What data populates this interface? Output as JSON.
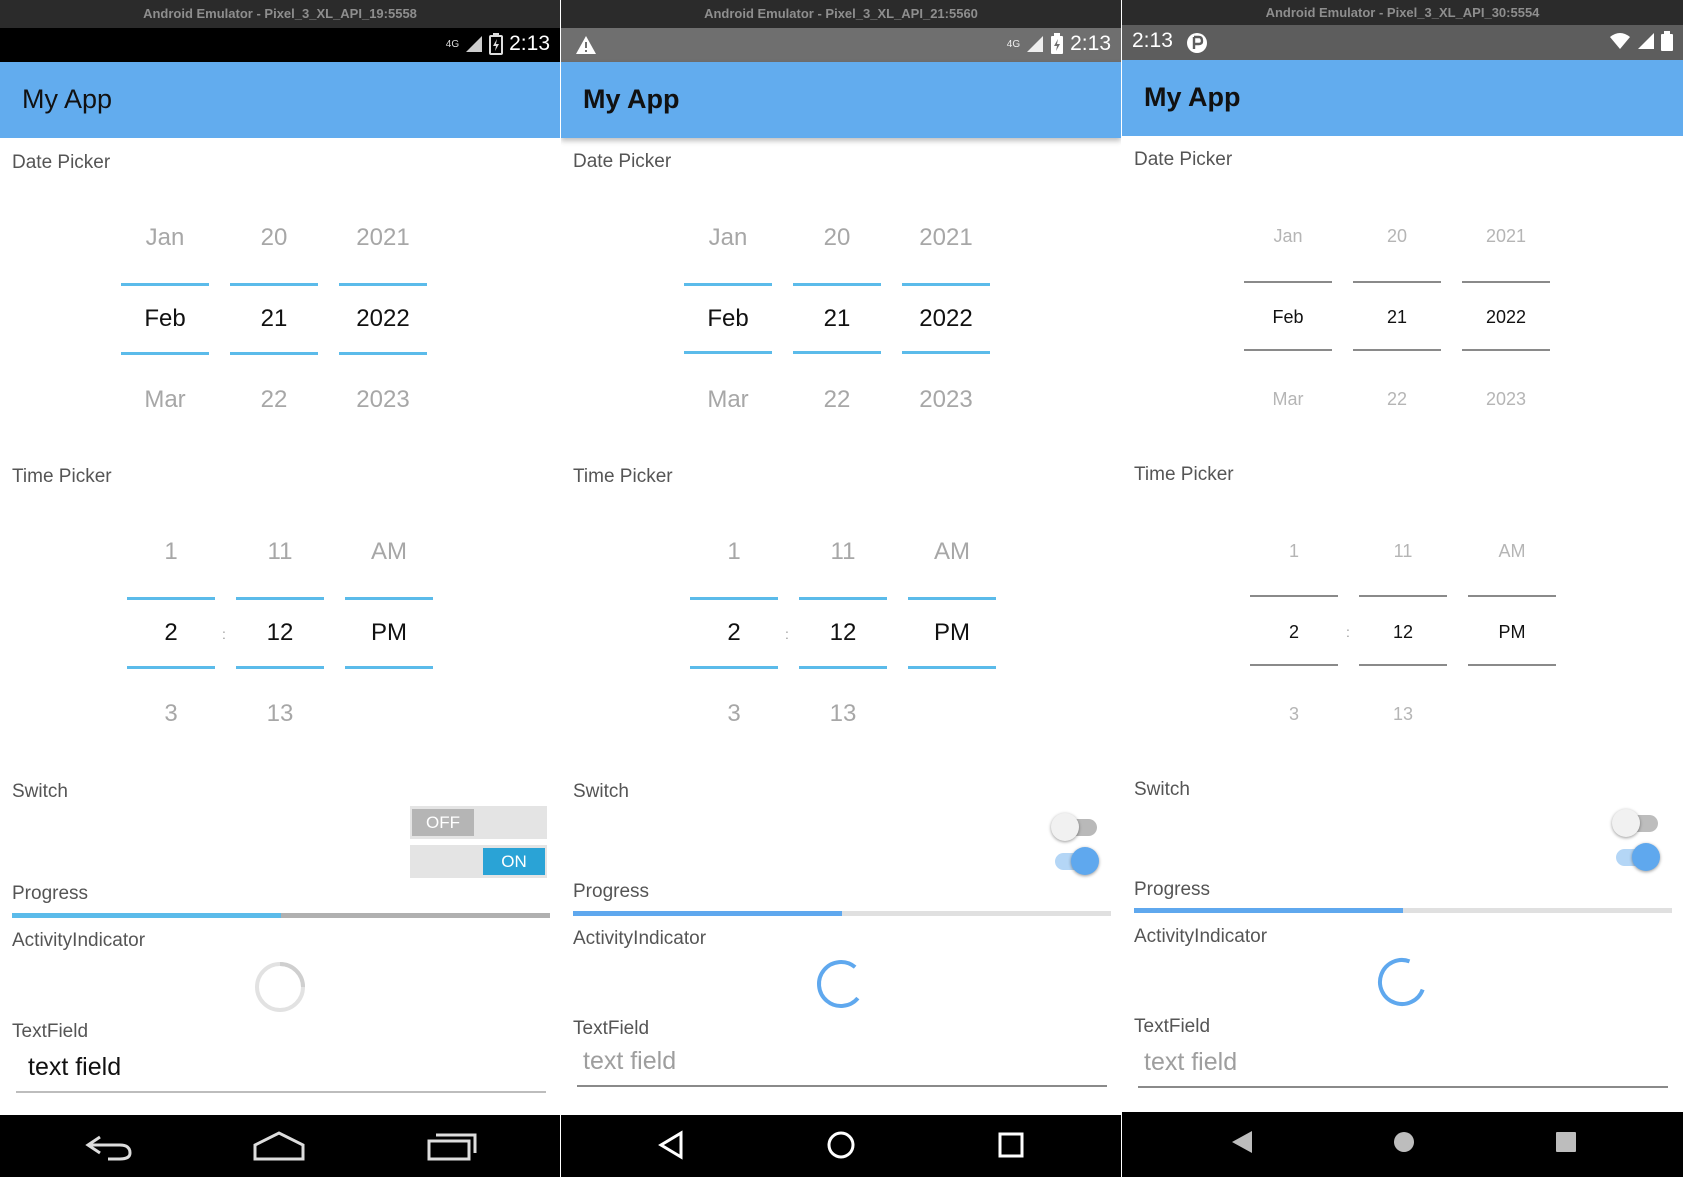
{
  "emulators": [
    {
      "window_title": "Android Emulator - Pixel_3_XL_API_19:5558",
      "status_time": "2:13",
      "status_network": "4G",
      "app_title": "My App",
      "labels": {
        "date": "Date Picker",
        "time": "Time Picker",
        "switch": "Switch",
        "progress": "Progress",
        "activity": "ActivityIndicator",
        "textfield": "TextField"
      },
      "date_picker": {
        "months": [
          "Jan",
          "Feb",
          "Mar"
        ],
        "days": [
          "20",
          "21",
          "22"
        ],
        "years": [
          "2021",
          "2022",
          "2023"
        ]
      },
      "time_picker": {
        "hours": [
          "1",
          "2",
          "3"
        ],
        "minutes": [
          "11",
          "12",
          "13"
        ],
        "ampm": [
          "AM",
          "PM"
        ],
        "separator": ":"
      },
      "switches": {
        "off_label": "OFF",
        "on_label": "ON"
      },
      "progress": 0.5,
      "textfield_value": "text field"
    },
    {
      "window_title": "Android Emulator - Pixel_3_XL_API_21:5560",
      "status_time": "2:13",
      "status_network": "4G",
      "app_title": "My App",
      "labels": {
        "date": "Date Picker",
        "time": "Time Picker",
        "switch": "Switch",
        "progress": "Progress",
        "activity": "ActivityIndicator",
        "textfield": "TextField"
      },
      "date_picker": {
        "months": [
          "Jan",
          "Feb",
          "Mar"
        ],
        "days": [
          "20",
          "21",
          "22"
        ],
        "years": [
          "2021",
          "2022",
          "2023"
        ]
      },
      "time_picker": {
        "hours": [
          "1",
          "2",
          "3"
        ],
        "minutes": [
          "11",
          "12",
          "13"
        ],
        "ampm": [
          "AM",
          "PM"
        ],
        "separator": ":"
      },
      "progress": 0.5,
      "textfield_placeholder": "text field"
    },
    {
      "window_title": "Android Emulator - Pixel_3_XL_API_30:5554",
      "status_time": "2:13",
      "app_title": "My App",
      "labels": {
        "date": "Date Picker",
        "time": "Time Picker",
        "switch": "Switch",
        "progress": "Progress",
        "activity": "ActivityIndicator",
        "textfield": "TextField"
      },
      "date_picker": {
        "months": [
          "Jan",
          "Feb",
          "Mar"
        ],
        "days": [
          "20",
          "21",
          "22"
        ],
        "years": [
          "2021",
          "2022",
          "2023"
        ]
      },
      "time_picker": {
        "hours": [
          "1",
          "2",
          "3"
        ],
        "minutes": [
          "11",
          "12",
          "13"
        ],
        "ampm": [
          "AM",
          "PM"
        ],
        "separator": ":"
      },
      "progress": 0.5,
      "textfield_placeholder": "text field"
    }
  ],
  "colors": {
    "appbar": "#62acee",
    "accent_blue": "#5fa8ee",
    "holo_blue": "#5bbbea",
    "switch_on_holo": "#2aa3d6"
  }
}
